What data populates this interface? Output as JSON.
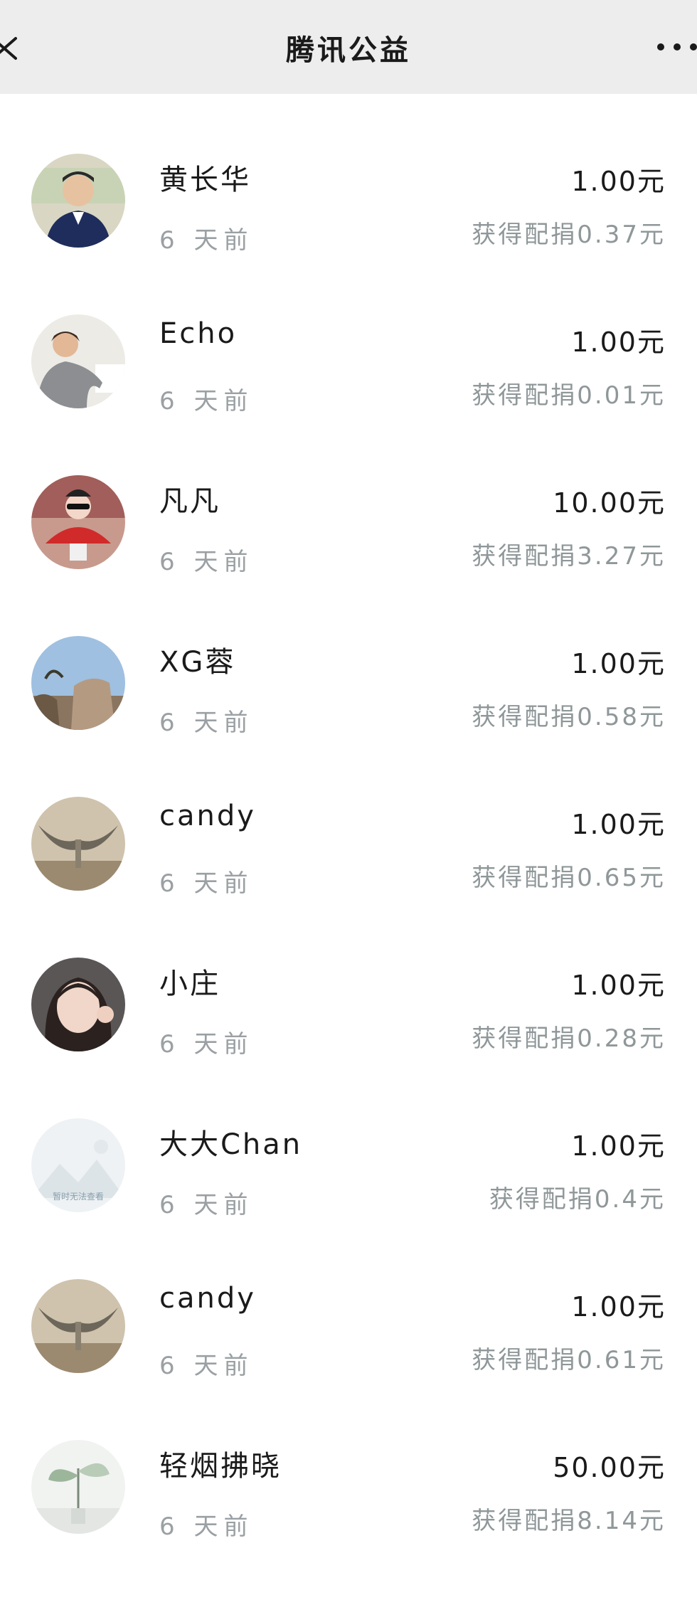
{
  "header": {
    "title": "腾讯公益",
    "close_icon": "close-icon",
    "more_icon": "more-icon"
  },
  "donations": [
    {
      "name": "黄长华",
      "time": "6 天前",
      "amount": "1.00元",
      "match": "获得配捐0.37元",
      "avatar_icon": "avatar-man-suit"
    },
    {
      "name": "Echo",
      "time": "6 天前",
      "amount": "1.00元",
      "match": "获得配捐0.01元",
      "avatar_icon": "avatar-woman-office"
    },
    {
      "name": "凡凡",
      "time": "6 天前",
      "amount": "10.00元",
      "match": "获得配捐3.27元",
      "avatar_icon": "avatar-cartoon-fan"
    },
    {
      "name": "XG蓉",
      "time": "6 天前",
      "amount": "1.00元",
      "match": "获得配捐0.58元",
      "avatar_icon": "avatar-rocks-sky"
    },
    {
      "name": "candy",
      "time": "6 天前",
      "amount": "1.00元",
      "match": "获得配捐0.65元",
      "avatar_icon": "avatar-bird"
    },
    {
      "name": "小庄",
      "time": "6 天前",
      "amount": "1.00元",
      "match": "获得配捐0.28元",
      "avatar_icon": "avatar-girl-selfie"
    },
    {
      "name": "大大Chan",
      "time": "6 天前",
      "amount": "1.00元",
      "match": "获得配捐0.4元",
      "avatar_icon": "avatar-placeholder",
      "avatar_text": "暂时无法查看"
    },
    {
      "name": "candy",
      "time": "6 天前",
      "amount": "1.00元",
      "match": "获得配捐0.61元",
      "avatar_icon": "avatar-bird"
    },
    {
      "name": "轻烟拂晓",
      "time": "6 天前",
      "amount": "50.00元",
      "match": "获得配捐8.14元",
      "avatar_icon": "avatar-plant"
    }
  ]
}
